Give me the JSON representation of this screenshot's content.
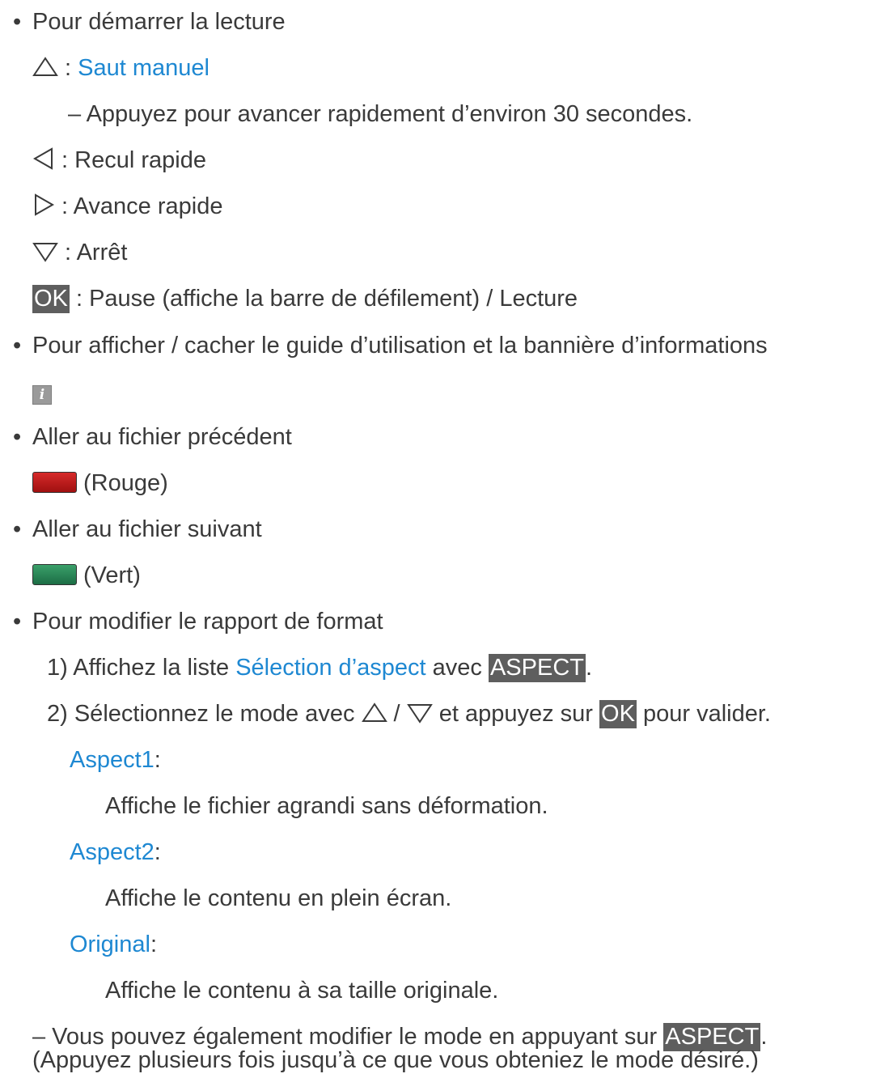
{
  "sections": {
    "play": {
      "bullet": "Pour démarrer la lecture",
      "up_sep": " : ",
      "up_label": "Saut manuel",
      "up_note": "–  Appuyez pour avancer rapidement d’environ 30 secondes.",
      "left_label": " : Recul rapide",
      "right_label": " : Avance rapide",
      "down_label": " : Arrêt",
      "ok_key": "OK",
      "ok_label": " : Pause (affiche la barre de défilement) / Lecture"
    },
    "guide": {
      "bullet": "Pour afficher / cacher le guide d’utilisation et la bannière d’informations",
      "icon_glyph": "i"
    },
    "prev": {
      "bullet": "Aller au fichier précédent",
      "label": "(Rouge)",
      "color": "#c01a1a"
    },
    "next": {
      "bullet": "Aller au fichier suivant",
      "label": "(Vert)",
      "color": "#2a8a58"
    },
    "aspect": {
      "bullet": "Pour modifier le rapport de format",
      "step1_pre": "1)  Affichez la liste ",
      "step1_link": "Sélection d’aspect",
      "step1_mid": " avec ",
      "step1_key": "ASPECT",
      "step1_post": ".",
      "step2_pre": "2)  Sélectionnez le mode avec ",
      "step2_slash": " / ",
      "step2_mid": " et appuyez sur ",
      "step2_key": "OK",
      "step2_post": " pour valider.",
      "modes": [
        {
          "name": "Aspect1",
          "colon": ":",
          "desc": "Affiche le fichier agrandi sans déformation."
        },
        {
          "name": "Aspect2",
          "colon": ":",
          "desc": "Affiche le contenu en plein écran."
        },
        {
          "name": "Original",
          "colon": ":",
          "desc": "Affiche le contenu à sa taille originale."
        }
      ],
      "note_pre": "–  Vous pouvez également modifier le mode en appuyant sur ",
      "note_key": "ASPECT",
      "note_post": ".",
      "note_line2": "(Appuyez plusieurs fois jusqu’à ce que vous obteniez le mode désiré.)"
    }
  },
  "bullet_char": "•"
}
